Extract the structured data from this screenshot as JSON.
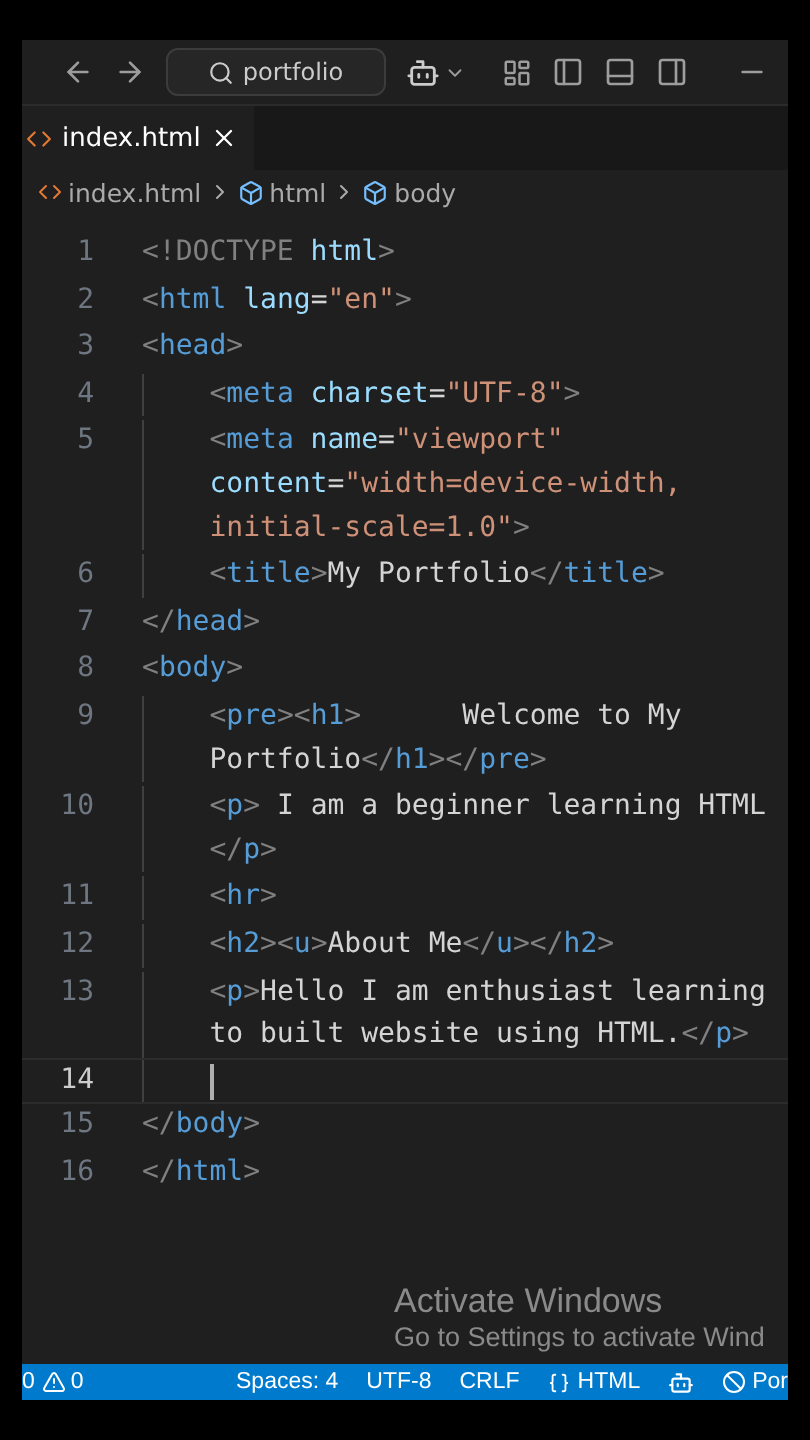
{
  "title_bar": {
    "search": {
      "value": "portfolio"
    }
  },
  "tabs": [
    {
      "label": "index.html",
      "selected": true
    }
  ],
  "breadcrumb": [
    "index.html",
    "html",
    "body"
  ],
  "editor": {
    "lines": [
      {
        "number": "1",
        "current": false,
        "rows": [
          {
            "segments": [
              {
                "kind": "punct",
                "text": "<!DOCTYPE "
              },
              {
                "kind": "attr",
                "text": "html"
              },
              {
                "kind": "punct",
                "text": ">"
              }
            ]
          }
        ]
      },
      {
        "number": "2",
        "current": false,
        "rows": [
          {
            "segments": [
              {
                "kind": "punct",
                "text": "<"
              },
              {
                "kind": "tag",
                "text": "html"
              },
              {
                "kind": "attr",
                "text": " lang"
              },
              {
                "kind": "plain",
                "text": "="
              },
              {
                "kind": "string",
                "text": "\"en\""
              },
              {
                "kind": "punct",
                "text": ">"
              }
            ]
          }
        ]
      },
      {
        "number": "3",
        "current": false,
        "rows": [
          {
            "segments": [
              {
                "kind": "punct",
                "text": "<"
              },
              {
                "kind": "tag",
                "text": "head"
              },
              {
                "kind": "punct",
                "text": ">"
              }
            ]
          }
        ]
      },
      {
        "number": "4",
        "current": false,
        "rows": [
          {
            "segments": [
              {
                "kind": "punct",
                "text": "    <"
              },
              {
                "kind": "tag",
                "text": "meta"
              },
              {
                "kind": "attr",
                "text": " charset"
              },
              {
                "kind": "plain",
                "text": "="
              },
              {
                "kind": "string",
                "text": "\"UTF-8\""
              },
              {
                "kind": "punct",
                "text": ">"
              }
            ]
          }
        ]
      },
      {
        "number": "5",
        "current": false,
        "rows": [
          {
            "segments": [
              {
                "kind": "punct",
                "text": "    <"
              },
              {
                "kind": "tag",
                "text": "meta"
              },
              {
                "kind": "attr",
                "text": " name"
              },
              {
                "kind": "plain",
                "text": "="
              },
              {
                "kind": "string",
                "text": "\"viewport\""
              }
            ]
          },
          {
            "segments": [
              {
                "kind": "attr",
                "text": "    content"
              },
              {
                "kind": "plain",
                "text": "="
              },
              {
                "kind": "string",
                "text": "\"width=device-width,"
              }
            ]
          },
          {
            "segments": [
              {
                "kind": "string",
                "text": "    initial-scale=1.0\""
              },
              {
                "kind": "punct",
                "text": ">"
              }
            ]
          }
        ]
      },
      {
        "number": "6",
        "current": false,
        "rows": [
          {
            "segments": [
              {
                "kind": "punct",
                "text": "    <"
              },
              {
                "kind": "tag",
                "text": "title"
              },
              {
                "kind": "punct",
                "text": ">"
              },
              {
                "kind": "plain",
                "text": "My Portfolio"
              },
              {
                "kind": "punct",
                "text": "</"
              },
              {
                "kind": "tag",
                "text": "title"
              },
              {
                "kind": "punct",
                "text": ">"
              }
            ]
          }
        ]
      },
      {
        "number": "7",
        "current": false,
        "rows": [
          {
            "segments": [
              {
                "kind": "punct",
                "text": "</"
              },
              {
                "kind": "tag",
                "text": "head"
              },
              {
                "kind": "punct",
                "text": ">"
              }
            ]
          }
        ]
      },
      {
        "number": "8",
        "current": false,
        "rows": [
          {
            "segments": [
              {
                "kind": "punct",
                "text": "<"
              },
              {
                "kind": "tag",
                "text": "body"
              },
              {
                "kind": "punct",
                "text": ">"
              }
            ]
          }
        ]
      },
      {
        "number": "9",
        "current": false,
        "rows": [
          {
            "segments": [
              {
                "kind": "punct",
                "text": "    <"
              },
              {
                "kind": "tag",
                "text": "pre"
              },
              {
                "kind": "punct",
                "text": "><"
              },
              {
                "kind": "tag",
                "text": "h1"
              },
              {
                "kind": "punct",
                "text": ">"
              },
              {
                "kind": "plain",
                "text": "      Welcome to My"
              }
            ]
          },
          {
            "segments": [
              {
                "kind": "plain",
                "text": "    Portfolio"
              },
              {
                "kind": "punct",
                "text": "</"
              },
              {
                "kind": "tag",
                "text": "h1"
              },
              {
                "kind": "punct",
                "text": "></"
              },
              {
                "kind": "tag",
                "text": "pre"
              },
              {
                "kind": "punct",
                "text": ">"
              }
            ]
          }
        ]
      },
      {
        "number": "10",
        "current": false,
        "rows": [
          {
            "segments": [
              {
                "kind": "punct",
                "text": "    <"
              },
              {
                "kind": "tag",
                "text": "p"
              },
              {
                "kind": "punct",
                "text": ">"
              },
              {
                "kind": "plain",
                "text": " I am a beginner learning HTML"
              }
            ]
          },
          {
            "segments": [
              {
                "kind": "punct",
                "text": "    </"
              },
              {
                "kind": "tag",
                "text": "p"
              },
              {
                "kind": "punct",
                "text": ">"
              }
            ]
          }
        ]
      },
      {
        "number": "11",
        "current": false,
        "rows": [
          {
            "segments": [
              {
                "kind": "punct",
                "text": "    <"
              },
              {
                "kind": "tag",
                "text": "hr"
              },
              {
                "kind": "punct",
                "text": ">"
              }
            ]
          }
        ]
      },
      {
        "number": "12",
        "current": false,
        "rows": [
          {
            "segments": [
              {
                "kind": "punct",
                "text": "    <"
              },
              {
                "kind": "tag",
                "text": "h2"
              },
              {
                "kind": "punct",
                "text": "><"
              },
              {
                "kind": "tag",
                "text": "u"
              },
              {
                "kind": "punct",
                "text": ">"
              },
              {
                "kind": "plain",
                "text": "About Me"
              },
              {
                "kind": "punct",
                "text": "</"
              },
              {
                "kind": "tag",
                "text": "u"
              },
              {
                "kind": "punct",
                "text": "></"
              },
              {
                "kind": "tag",
                "text": "h2"
              },
              {
                "kind": "punct",
                "text": ">"
              }
            ]
          }
        ]
      },
      {
        "number": "13",
        "current": false,
        "rows": [
          {
            "segments": [
              {
                "kind": "punct",
                "text": "    <"
              },
              {
                "kind": "tag",
                "text": "p"
              },
              {
                "kind": "punct",
                "text": ">"
              },
              {
                "kind": "plain",
                "text": "Hello I am enthusiast learning"
              }
            ]
          },
          {
            "segments": [
              {
                "kind": "plain",
                "text": "    to built website using HTML."
              },
              {
                "kind": "punct",
                "text": "</"
              },
              {
                "kind": "tag",
                "text": "p"
              },
              {
                "kind": "punct",
                "text": ">"
              }
            ]
          }
        ]
      },
      {
        "number": "14",
        "current": true
      },
      {
        "number": "15",
        "current": false,
        "rows": [
          {
            "segments": [
              {
                "kind": "punct",
                "text": "</"
              },
              {
                "kind": "tag",
                "text": "body"
              },
              {
                "kind": "punct",
                "text": ">"
              }
            ]
          }
        ]
      },
      {
        "number": "16",
        "current": false,
        "rows": [
          {
            "segments": [
              {
                "kind": "punct",
                "text": "</"
              },
              {
                "kind": "tag",
                "text": "html"
              },
              {
                "kind": "punct",
                "text": ">"
              }
            ]
          }
        ]
      }
    ]
  },
  "activation_notice": {
    "title": "Activate Windows",
    "message": "Go to Settings to activate Wind"
  },
  "status_bar": {
    "errors": "0",
    "warnings": "0",
    "items": [
      "Spaces: 4",
      "UTF-8",
      "CRLF"
    ],
    "language": "HTML",
    "ports": "Por"
  }
}
